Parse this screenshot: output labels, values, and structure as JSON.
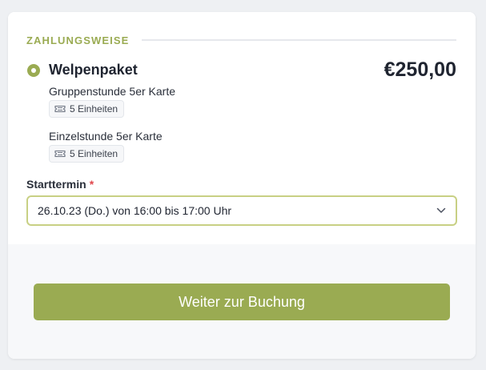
{
  "section": {
    "title": "ZAHLUNGSWEISE"
  },
  "package": {
    "name": "Welpenpaket",
    "price": "€250,00",
    "selected": true,
    "items": [
      {
        "name": "Gruppenstunde 5er Karte",
        "badge": "5 Einheiten",
        "badge_icon": "ticket-icon"
      },
      {
        "name": "Einzelstunde 5er Karte",
        "badge": "5 Einheiten",
        "badge_icon": "ticket-icon"
      }
    ]
  },
  "start": {
    "label": "Starttermin",
    "required_marker": "*",
    "selected_value": "26.10.23 (Do.) von 16:00 bis 17:00 Uhr"
  },
  "cta": {
    "label": "Weiter zur Buchung"
  },
  "colors": {
    "accent": "#9aab52",
    "required": "#e0474c",
    "select_border": "#c8d084",
    "text": "#1f2430"
  }
}
